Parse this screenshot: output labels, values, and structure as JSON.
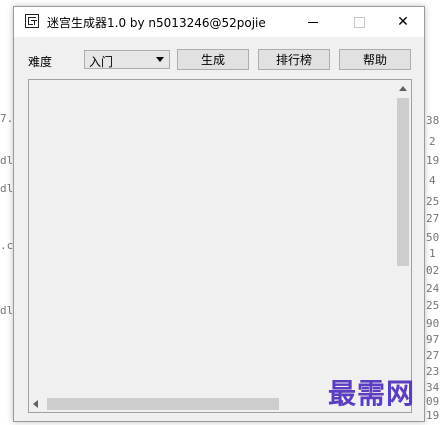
{
  "window": {
    "title": "迷宫生成器1.0 by n5013246@52pojie",
    "controls": {
      "minimize": "—",
      "maximize": "□",
      "close": "✕"
    }
  },
  "toolbar": {
    "difficulty_label": "难度",
    "difficulty_value": "入门",
    "generate_label": "生成",
    "leaderboard_label": "排行榜",
    "help_label": "帮助"
  },
  "scrollbar_glyphs": {
    "up": "^",
    "left": "<"
  },
  "watermark": {
    "text": "最需网"
  },
  "background_fragments": {
    "left": [
      "7.",
      "dl",
      "dl",
      ".c",
      "dl"
    ],
    "right": [
      "38",
      "2",
      "19",
      "4",
      "25",
      "27",
      "50",
      "1",
      "02",
      "24",
      "25",
      "90",
      "97",
      "27",
      "23",
      "34",
      "09",
      "19"
    ]
  }
}
